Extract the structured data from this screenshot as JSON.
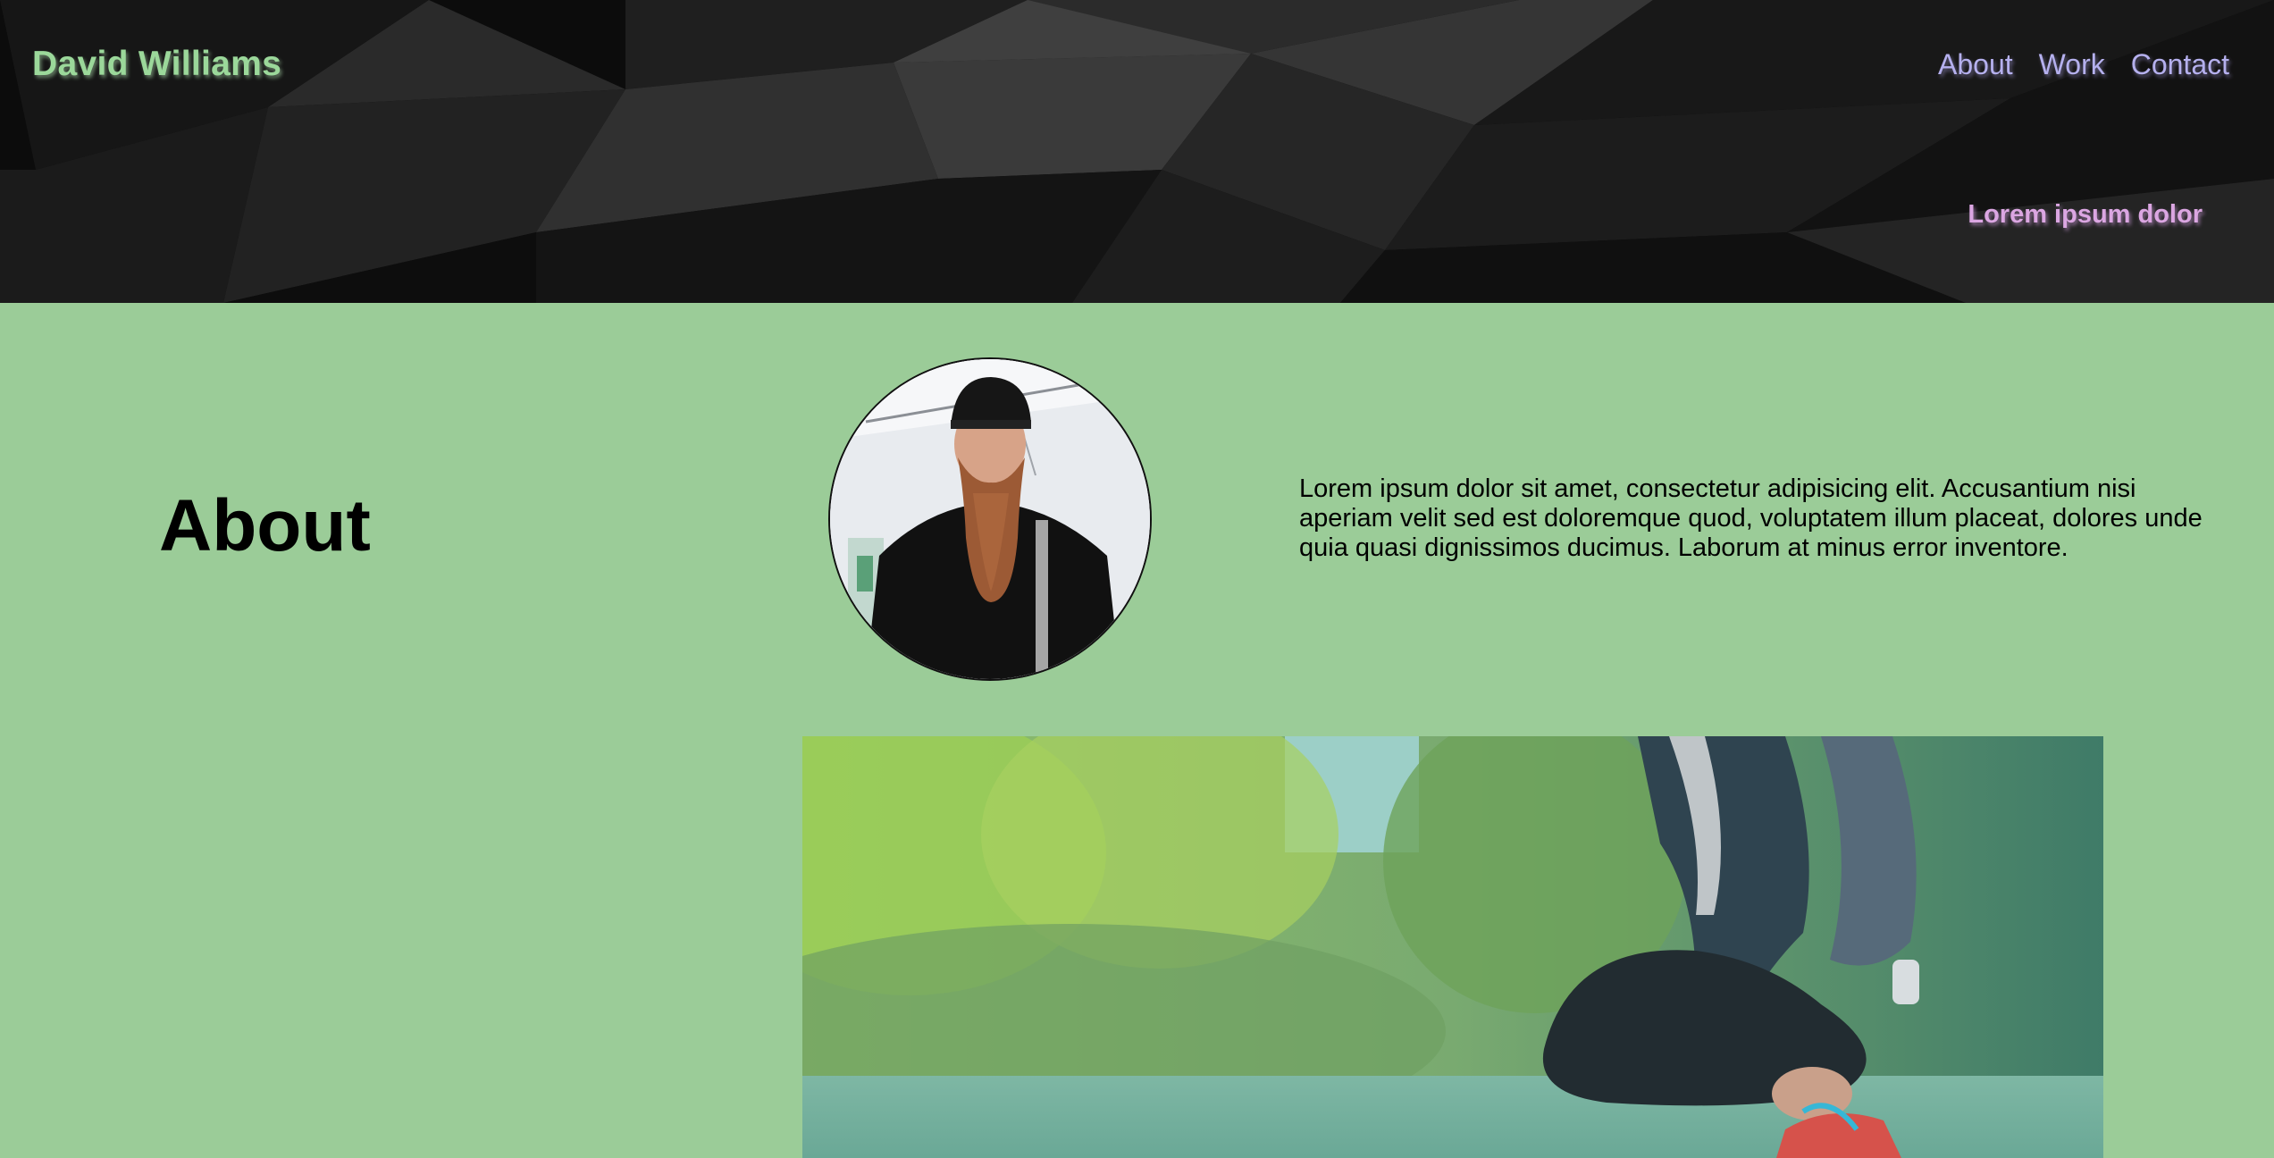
{
  "header": {
    "brand": "David Williams",
    "nav": [
      "About",
      "Work",
      "Contact"
    ],
    "tagline": "Lorem ipsum dolor"
  },
  "about": {
    "title": "About",
    "text": "Lorem ipsum dolor sit amet, consectetur adipisicing elit. Accusantium nisi aperiam velit sed est doloremque quod, voluptatem illum placeat, dolores unde quia quasi dignissimos ducimus. Laborum at minus error inventore."
  },
  "colors": {
    "page_background": "#9bcc98",
    "header_background": "#0c0c0c",
    "brand": "#9bd89a",
    "nav_link": "#b5b0ee",
    "tagline": "#dba6e2"
  }
}
